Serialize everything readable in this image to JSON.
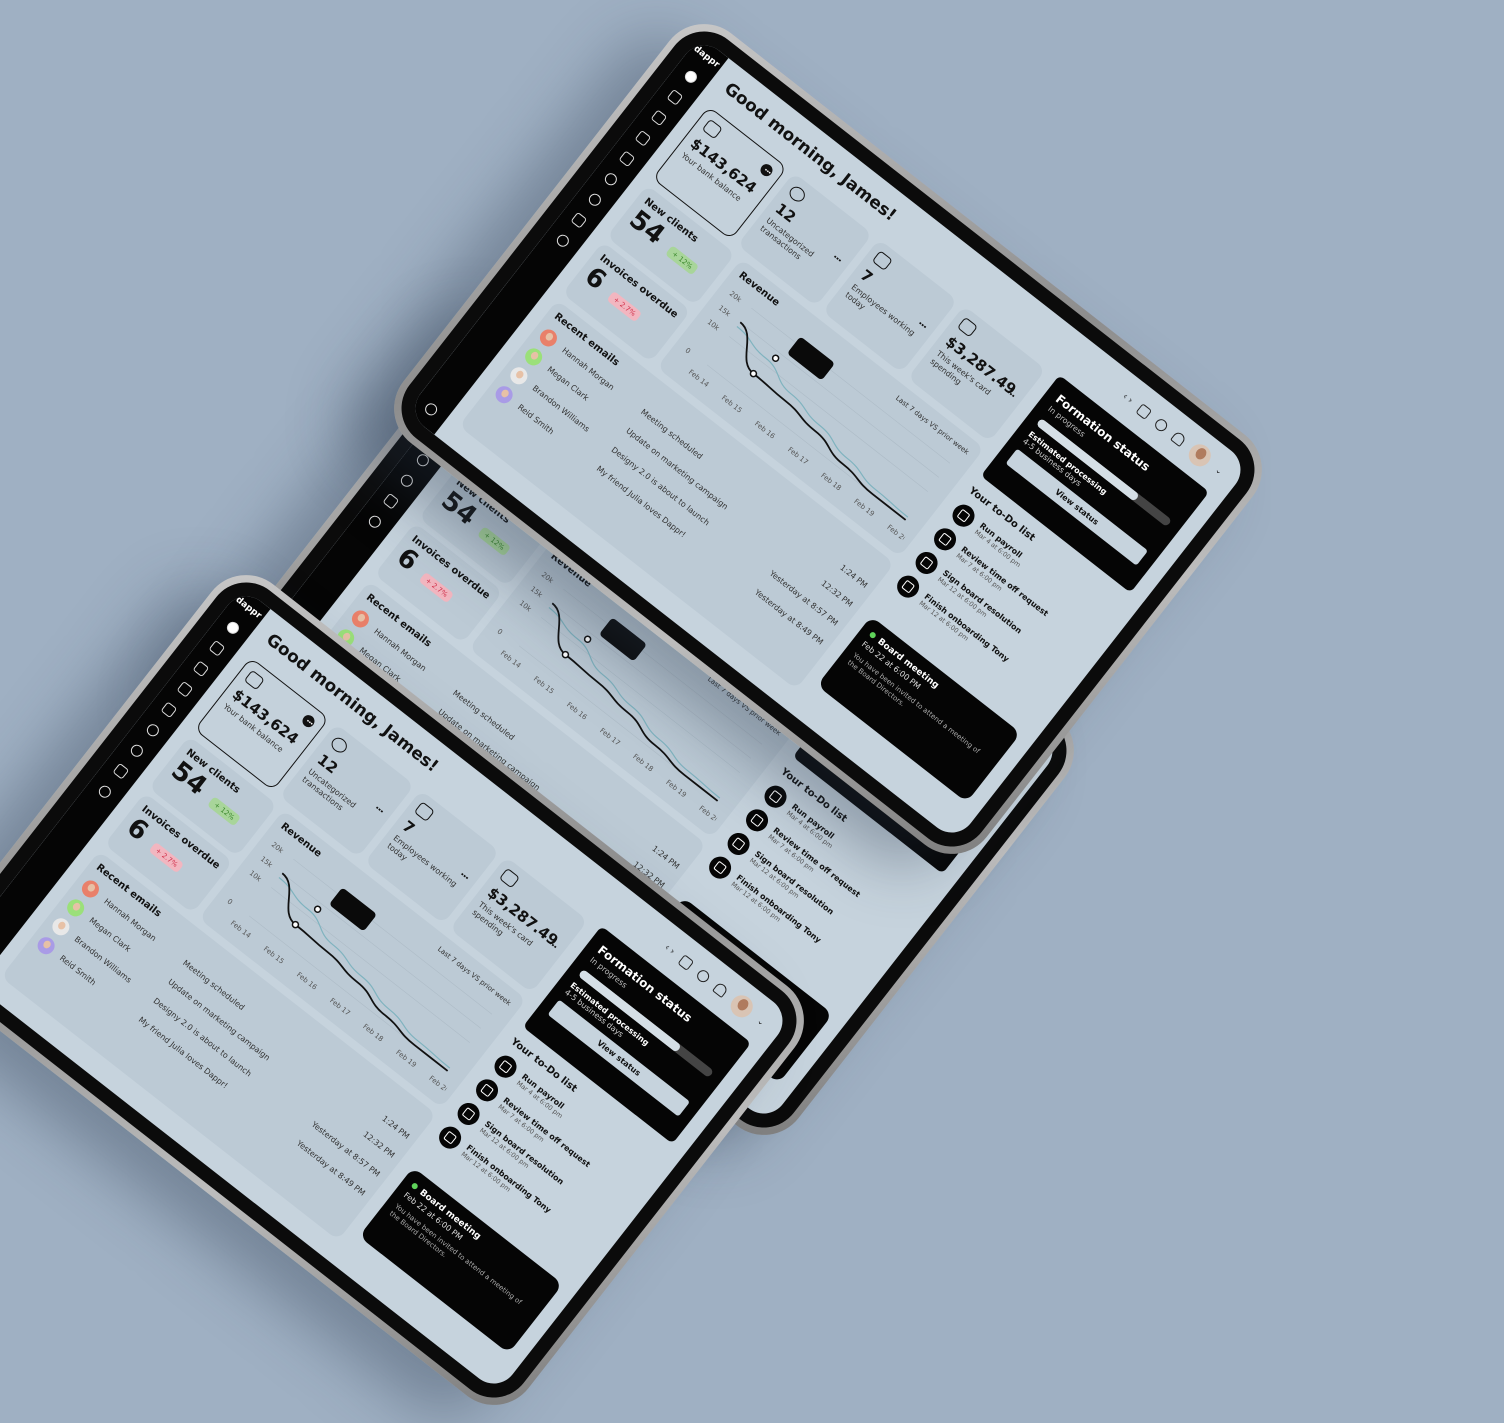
{
  "app": {
    "logo": "dappr"
  },
  "header": {
    "greeting": "Good morning, James!"
  },
  "stats": [
    {
      "value": "$143,624",
      "label": "Your bank balance",
      "icon": "wallet-icon"
    },
    {
      "value": "12",
      "label": "Uncategorized transactions",
      "icon": "pie-chart-icon"
    },
    {
      "value": "7",
      "label": "Employees working today",
      "icon": "employees-icon"
    },
    {
      "value": "$3,287.49",
      "label": "This week's card spending",
      "icon": "card-spending-icon"
    }
  ],
  "new_clients": {
    "title": "New clients",
    "value": "54",
    "badge": "+ 12%"
  },
  "invoices": {
    "title": "Invoices overdue",
    "value": "6",
    "badge": "+ 2.7%"
  },
  "revenue": {
    "title": "Revenue",
    "legend": "Last 7 days VS prior week",
    "chart_data": {
      "type": "line",
      "categories": [
        "Feb 14",
        "Feb 15",
        "Feb 16",
        "Feb 17",
        "Feb 18",
        "Feb 19",
        "Feb 20"
      ],
      "y_ticks": [
        "0",
        "10k",
        "15k",
        "20k"
      ],
      "ylim": [
        0,
        20000
      ],
      "series": [
        {
          "values": [
            15000,
            6000,
            5500,
            4000,
            1500,
            0,
            0
          ],
          "color": "#111111"
        },
        {
          "values": [
            13500,
            11500,
            8000,
            6000,
            3500,
            1500,
            1000
          ],
          "color": "#7fb3bf"
        }
      ]
    }
  },
  "emails": {
    "title": "Recent emails",
    "rows": [
      {
        "name": "Hannah Morgan",
        "subject": "Meeting scheduled",
        "time": "1:24 PM",
        "avatar_color": "#e9806a"
      },
      {
        "name": "Megan Clark",
        "subject": "Update on marketing campaign",
        "time": "12:32 PM",
        "avatar_color": "#9be07a"
      },
      {
        "name": "Brandon Williams",
        "subject": "Designy 2.0 is about to launch",
        "time": "Yesterday at 8:57 PM",
        "avatar_color": "#e8e8e8"
      },
      {
        "name": "Reid Smith",
        "subject": "My friend Julia loves Dappr!",
        "time": "Yesterday at 8:49 PM",
        "avatar_color": "#a99be6"
      }
    ]
  },
  "formation": {
    "title": "Formation status",
    "status": "In progress",
    "progress": 0.75,
    "estimate_label": "Estimated processing",
    "estimate_value": "4-5 business days",
    "button": "View status"
  },
  "todo": {
    "title": "Your to-Do list",
    "items": [
      {
        "title": "Run payroll",
        "date": "Mar 4 at 6:00 pm"
      },
      {
        "title": "Review time off request",
        "date": "Mar 7 at 6:00 pm"
      },
      {
        "title": "Sign board resolution",
        "date": "Mar 12 at 6:00 pm"
      },
      {
        "title": "Finish onboarding Tony",
        "date": "Mar 12 at 6:00 pm"
      }
    ]
  },
  "meeting": {
    "title": "Board meeting",
    "date": "Feb 22 at 6:00 PM",
    "text": "You have been invited to attend a meeting of the Board Directors.",
    "status_color": "#5fd35a"
  }
}
